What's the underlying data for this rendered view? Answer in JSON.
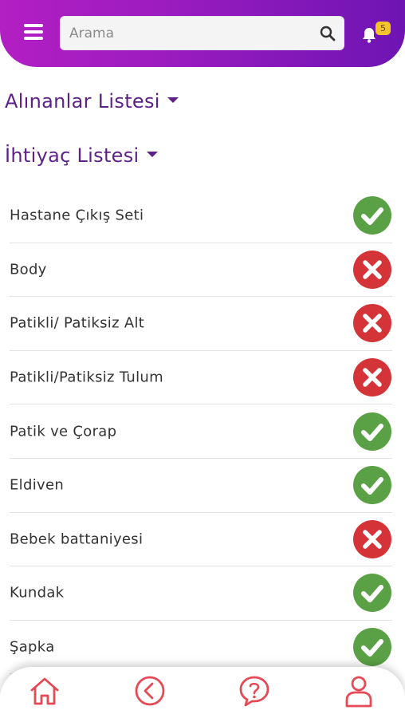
{
  "header": {
    "search_placeholder": "Arama",
    "notification_count": "5"
  },
  "sections": {
    "received_title": "Alınanlar Listesi",
    "needs_title": "İhtiyaç Listesi"
  },
  "items": [
    {
      "label": "Hastane Çıkış Seti",
      "status": "check-icon"
    },
    {
      "label": "Body",
      "status": "cross-icon"
    },
    {
      "label": "Patikli/ Patiksiz Alt",
      "status": "cross-icon"
    },
    {
      "label": "Patikli/Patiksiz Tulum",
      "status": "cross-icon"
    },
    {
      "label": "Patik ve Çorap",
      "status": "check-icon"
    },
    {
      "label": "Eldiven",
      "status": "check-icon"
    },
    {
      "label": "Bebek battaniyesi",
      "status": "cross-icon"
    },
    {
      "label": "Kundak",
      "status": "check-icon"
    },
    {
      "label": "Şapka",
      "status": "check-icon"
    }
  ],
  "bottom_nav": [
    "home-icon",
    "back-icon",
    "help-icon",
    "user-icon"
  ],
  "colors": {
    "accent_purple": "#9c1cc0",
    "title_purple": "#5d2188",
    "check_green": "#5aa145",
    "cross_red": "#d43438",
    "nav_red": "#e54a55",
    "badge_yellow": "#f4c32c"
  }
}
